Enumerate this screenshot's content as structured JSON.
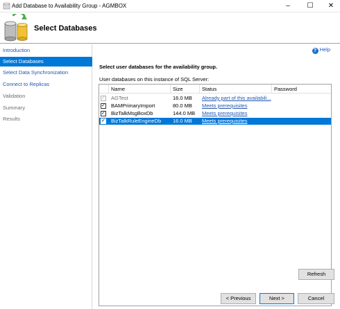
{
  "window": {
    "title": "Add Database to Availability Group - AGMBOX"
  },
  "header": {
    "title": "Select Databases"
  },
  "nav": {
    "items": [
      {
        "label": "Introduction",
        "state": "link"
      },
      {
        "label": "Select Databases",
        "state": "selected"
      },
      {
        "label": "Select Data Synchronization",
        "state": "link"
      },
      {
        "label": "Connect to Replicas",
        "state": "link"
      },
      {
        "label": "Validation",
        "state": "disabled"
      },
      {
        "label": "Summary",
        "state": "disabled"
      },
      {
        "label": "Results",
        "state": "disabled"
      }
    ]
  },
  "help": {
    "label": "Help"
  },
  "main": {
    "section_title": "Select user databases for the availability group.",
    "list_caption": "User databases on this instance of SQL Server:"
  },
  "table": {
    "columns": [
      "Name",
      "Size",
      "Status",
      "Password"
    ],
    "rows": [
      {
        "name": "AGTest",
        "size": "16.0 MB",
        "status": "Already part of this availabili...",
        "checked": true,
        "disabled": true,
        "selected": false
      },
      {
        "name": "BAMPrimaryImport",
        "size": "80.0 MB",
        "status": "Meets prerequisites",
        "checked": true,
        "disabled": false,
        "selected": false
      },
      {
        "name": "BizTalkMsgBoxDb",
        "size": "144.0 MB",
        "status": "Meets prerequisites",
        "checked": true,
        "disabled": false,
        "selected": false
      },
      {
        "name": "BizTalkRuleEngineDb",
        "size": "16.0 MB",
        "status": "Meets prerequisites",
        "checked": true,
        "disabled": false,
        "selected": true
      }
    ]
  },
  "buttons": {
    "refresh": "Refresh",
    "previous": "< Previous",
    "next": "Next >",
    "cancel": "Cancel"
  },
  "colors": {
    "selection": "#0078d7",
    "link": "#1e56b4"
  }
}
